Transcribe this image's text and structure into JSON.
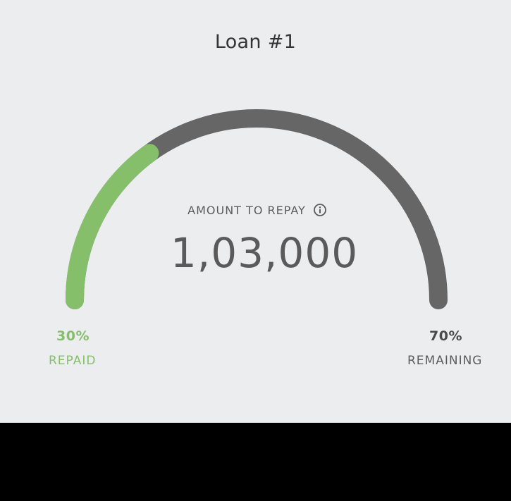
{
  "title": "Loan #1",
  "amount": {
    "label": "AMOUNT TO REPAY",
    "value": "1,03,000",
    "info_icon": "info-icon"
  },
  "gauge": {
    "repaid_fraction": 0.3,
    "repaid_color": "#86bf6a",
    "remaining_color": "#666666"
  },
  "repaid": {
    "percent": "30%",
    "label": "REPAID"
  },
  "remaining": {
    "percent": "70%",
    "label": "REMAINING"
  },
  "colors": {
    "background": "#ebedef",
    "text_dark": "#333333"
  }
}
